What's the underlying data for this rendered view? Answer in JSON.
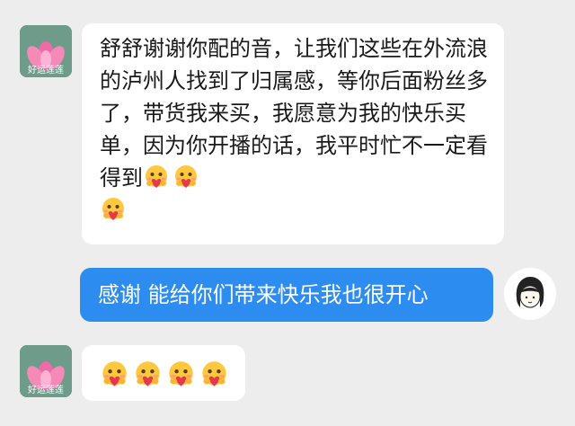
{
  "messages": [
    {
      "side": "left",
      "sender_caption": "好运莲莲",
      "text": "舒舒谢谢你配的音，让我们这些在外流浪的泸州人找到了归属感，等你后面粉丝多了，带货我来买，我愿意为我的快乐买单，因为你开播的话，我平时忙不一定看得到",
      "emojis": [
        "hug-emoji",
        "hug-emoji",
        "hug-emoji"
      ]
    },
    {
      "side": "right",
      "text": "感谢 能给你们带来快乐我也很开心"
    },
    {
      "side": "left",
      "sender_caption": "好运莲莲",
      "text": "",
      "emojis": [
        "hug-emoji",
        "hug-emoji",
        "hug-emoji",
        "hug-emoji"
      ]
    }
  ],
  "colors": {
    "background": "#ededed",
    "incoming_bubble": "#ffffff",
    "outgoing_bubble": "#2d8cf0",
    "emoji_face": "#ffc83d",
    "heart": "#e8384f"
  }
}
